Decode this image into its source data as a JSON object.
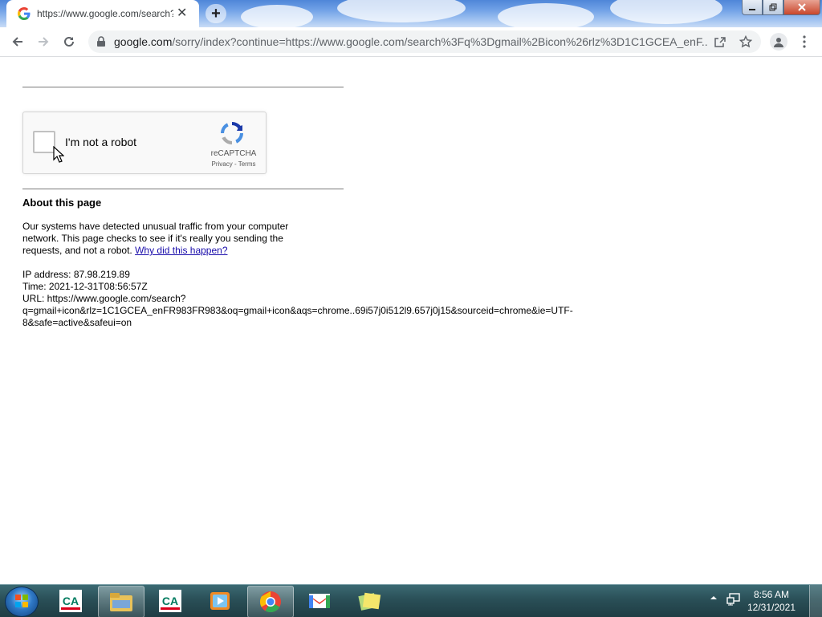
{
  "browser": {
    "tab_title": "https://www.google.com/search?q=gmail+icon",
    "tab_close": "✕",
    "new_tab": "+",
    "url_host": "google.com",
    "url_path": "/sorry/index?continue=https://www.google.com/search%3Fq%3Dgmail%2Bicon%26rlz%3D1C1GCEA_enF...",
    "icons": [
      "back-arrow-icon",
      "forward-arrow-icon",
      "reload-icon",
      "lock-icon",
      "share-icon",
      "bookmark-star-icon",
      "profile-icon",
      "menu-icon"
    ]
  },
  "recaptcha": {
    "label": "I'm not a robot",
    "brand": "reCAPTCHA",
    "privacy": "Privacy",
    "separator": " - ",
    "terms": "Terms",
    "checked": false
  },
  "about": {
    "heading": "About this page",
    "line1": "Our systems have detected unusual traffic from your computer",
    "line2": "network. This page checks to see if it's really you sending the",
    "line3_prefix": "requests, and not a robot. ",
    "why_link": "Why did this happen?"
  },
  "details": {
    "ip": "IP address: 87.98.219.89",
    "time": "Time: 2021-12-31T08:56:57Z",
    "url_line1": "URL: https://www.google.com/search?",
    "url_line2": "q=gmail+icon&rlz=1C1GCEA_enFR983FR983&oq=gmail+icon&aqs=chrome..69i57j0i512l9.657j0j15&sourceid=chrome&ie=UTF-",
    "url_line3": "8&safe=active&safeui=on"
  },
  "taskbar": {
    "time": "8:56 AM",
    "date": "12/31/2021",
    "pinned": [
      "credit-agricole-app",
      "file-explorer",
      "credit-agricole-app",
      "media-player",
      "chrome",
      "gmail",
      "sticky-notes"
    ],
    "colors": {
      "chrome_red": "#ea4335",
      "chrome_green": "#34a853",
      "chrome_yellow": "#fbbc05",
      "chrome_blue": "#4285f4"
    }
  }
}
